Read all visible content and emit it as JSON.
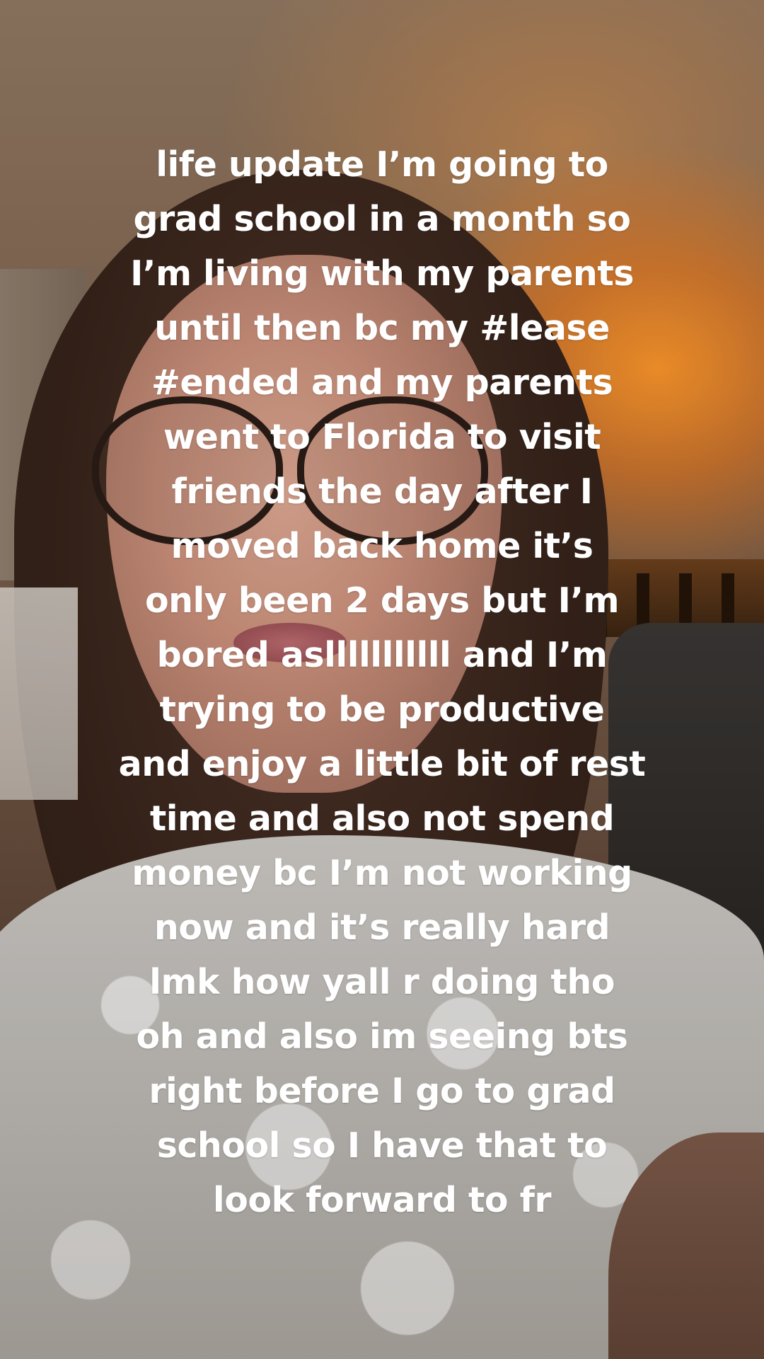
{
  "caption": {
    "lines": [
      "life update I’m going to",
      "grad school in a month so",
      "I’m living with my parents",
      "until then bc my #lease",
      "#ended and my parents",
      "went to Florida to visit",
      "friends the day after I",
      "moved back home it’s",
      "only been 2 days but I’m",
      "bored aslllllllllll and I’m",
      "trying to be productive",
      "and enjoy a little bit of rest",
      "time and also not spend",
      "money bc I’m not working",
      "now and it’s really hard",
      "lmk how yall r doing tho",
      "oh and also im seeing bts",
      "right before I go to grad",
      "school so I have that to",
      "look forward to fr"
    ]
  },
  "colors": {
    "caption_text": "#ffffff",
    "background_glow": "#ff9628"
  }
}
